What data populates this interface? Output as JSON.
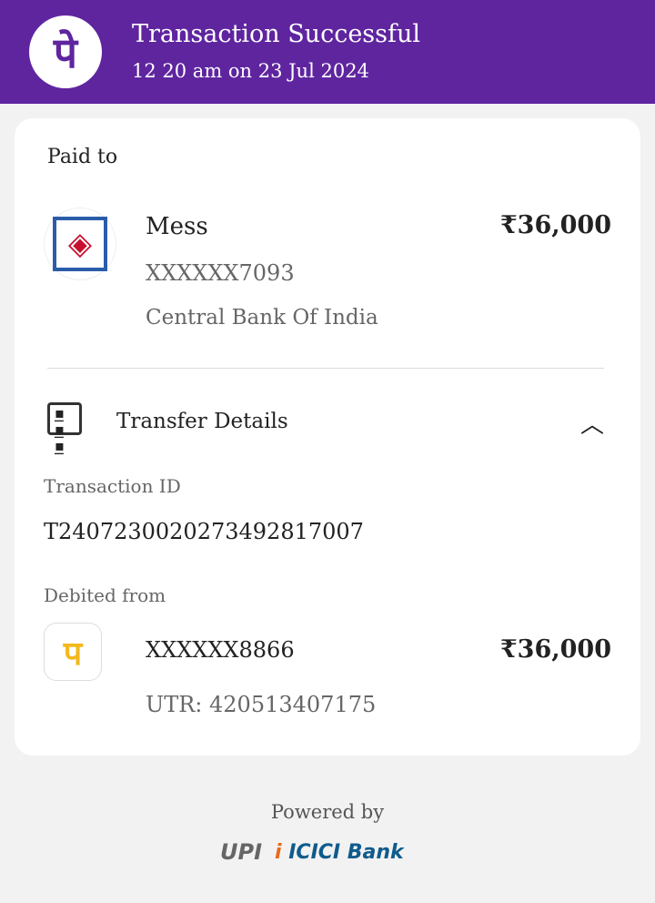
{
  "header": {
    "logo": "पे",
    "title": "Transaction Successful",
    "subtitle": "12 20 am on 23 Jul 2024"
  },
  "paid_to": {
    "label": "Paid to",
    "name": "Mess",
    "amount": "₹36,000",
    "account": "XXXXXX7093",
    "bank": "Central Bank Of India"
  },
  "transfer": {
    "title": "Transfer Details",
    "txn_label": "Transaction ID",
    "txn_id": "T2407230020273492817007",
    "debited_label": "Debited from",
    "account": "XXXXXX8866",
    "amount": "₹36,000",
    "utr": "UTR: 420513407175"
  },
  "footer": {
    "powered": "Powered by",
    "upi": "UPI",
    "bank": "ICICI Bank"
  },
  "colors": {
    "brand": "#5f259f"
  }
}
